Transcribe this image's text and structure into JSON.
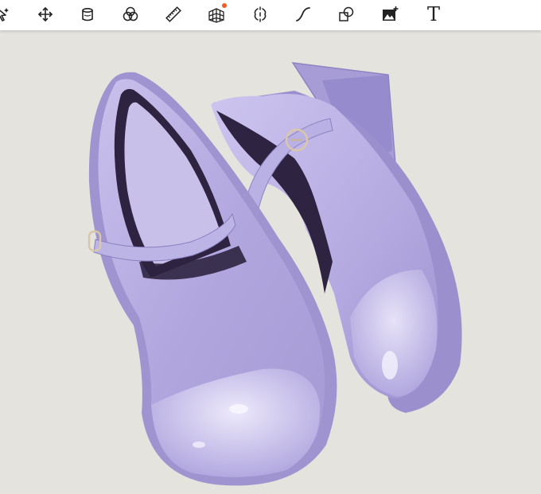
{
  "toolbar": {
    "tools": [
      {
        "icon": "selection-arrow-icon"
      },
      {
        "icon": "move-transform-icon"
      },
      {
        "icon": "fill-bucket-icon"
      },
      {
        "icon": "blend-circles-icon"
      },
      {
        "icon": "ruler-icon"
      },
      {
        "icon": "perspective-grid-icon",
        "notification": true
      },
      {
        "icon": "symmetry-icon"
      },
      {
        "icon": "curve-stroke-icon"
      },
      {
        "icon": "shapes-icon"
      },
      {
        "icon": "insert-image-icon"
      },
      {
        "icon": "text-tool-icon",
        "glyph": "T"
      }
    ],
    "notification_color": "#f05a28"
  },
  "canvas": {
    "artwork": "lavender-mary-jane-shoes-drawing",
    "background_color": "#e4e3dd",
    "shoe_color": "#b6ace0",
    "lining_color": "#2e2340"
  }
}
